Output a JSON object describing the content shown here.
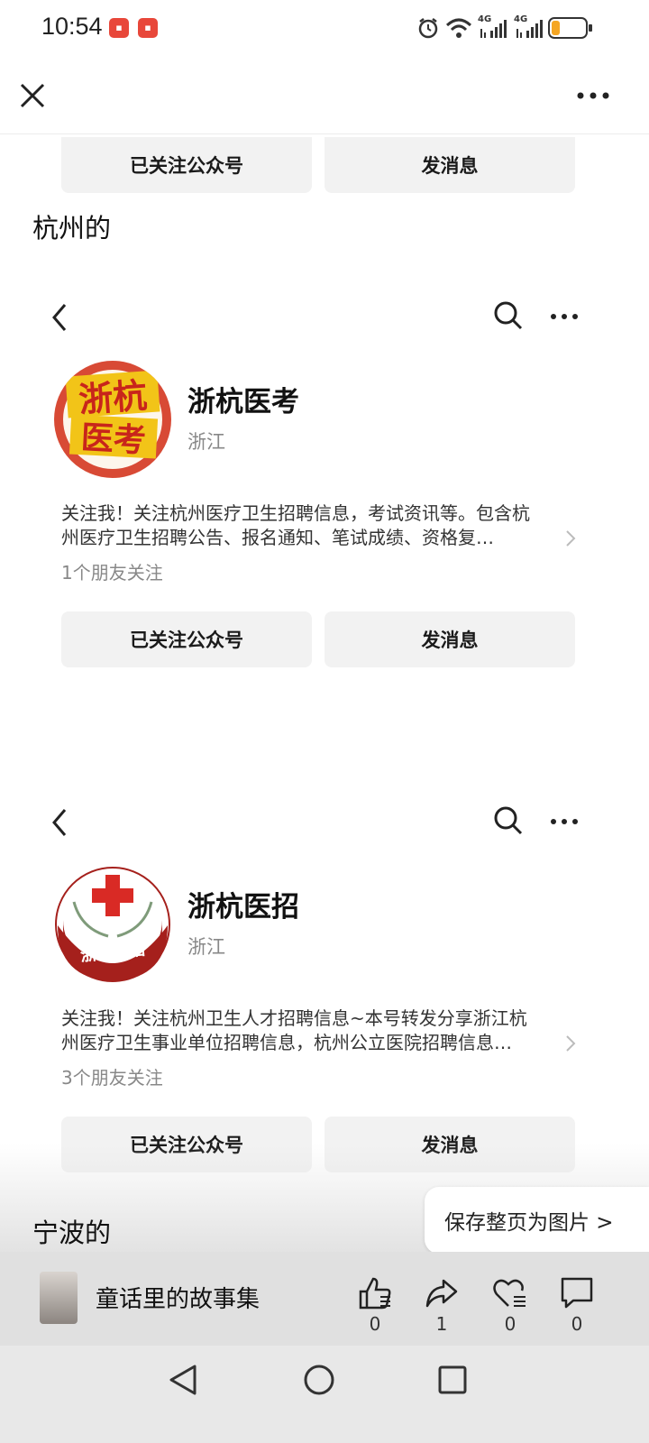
{
  "status_bar": {
    "time": "10:54",
    "signal1": "4G",
    "signal2": "4G",
    "icons": [
      "alarm-icon",
      "wifi-icon",
      "signal-icon",
      "battery-icon"
    ]
  },
  "top_nav": {
    "close_icon": "close-icon",
    "more_icon": "more-icon"
  },
  "first_buttons": {
    "follow": "已关注公众号",
    "message": "发消息"
  },
  "sections": [
    {
      "title": "杭州的"
    },
    {
      "title": "宁波的"
    }
  ],
  "cards": [
    {
      "name": "浙杭医考",
      "region": "浙江",
      "logo_text_1": "浙杭",
      "logo_text_2": "医考",
      "desc_line1": "关注我！关注杭州医疗卫生招聘信息，考试资讯等。包含杭",
      "desc_line2": "州医疗卫生招聘公告、报名通知、笔试成绩、资格复…",
      "friends": "1个朋友关注",
      "follow": "已关注公众号",
      "message": "发消息"
    },
    {
      "name": "浙杭医招",
      "region": "浙江",
      "logo_text": "浙杭医招",
      "desc_line1": "关注我！关注杭州卫生人才招聘信息~本号转发分享浙江杭",
      "desc_line2": "州医疗卫生事业单位招聘信息，杭州公立医院招聘信息…",
      "friends": "3个朋友关注",
      "follow": "已关注公众号",
      "message": "发消息"
    }
  ],
  "save_page": "保存整页为图片 >",
  "author": {
    "name": "童话里的故事集"
  },
  "stats": [
    {
      "icon": "thumbs-up-icon",
      "count": "0"
    },
    {
      "icon": "share-icon",
      "count": "1"
    },
    {
      "icon": "heart-icon",
      "count": "0"
    },
    {
      "icon": "comment-icon",
      "count": "0"
    }
  ],
  "colors": {
    "accent_red": "#d23a2a",
    "logo_yellow": "#f2c418",
    "button_bg": "#f2f2f2"
  }
}
